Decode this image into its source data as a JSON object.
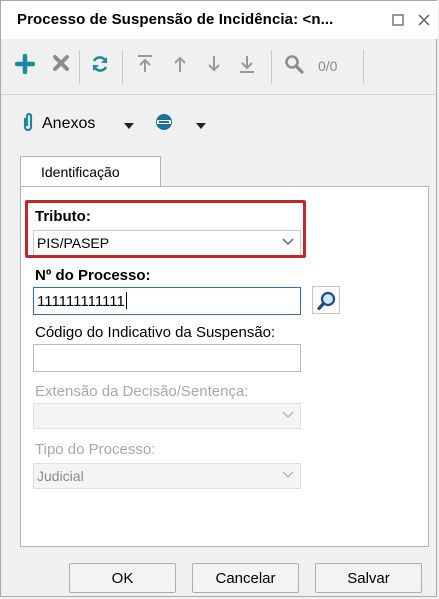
{
  "window": {
    "title": "Processo de Suspensão de Incidência: <n...",
    "maximize_icon": "maximize-icon",
    "close_icon": "close-icon"
  },
  "toolbar": {
    "items": [
      "add-icon",
      "delete-icon",
      "refresh-icon",
      "move-first-icon",
      "move-up-icon",
      "move-down-icon",
      "move-last-icon",
      "search-icon"
    ],
    "search_count": "0/0",
    "colors": {
      "add": "#1c8a9a",
      "delete": "#8d8d8d",
      "refresh": "#1c8a9a",
      "arrows": "#9a9a9a"
    }
  },
  "attachments": {
    "label": "Anexos",
    "icon": "paperclip-icon",
    "second_icon": "eye-icon"
  },
  "tabs": [
    {
      "label": "Identificação",
      "active": true
    }
  ],
  "form": {
    "tributo": {
      "label": "Tributo:",
      "value": "PIS/PASEP"
    },
    "numero_processo": {
      "label": "Nº do Processo:",
      "value": "111111111111"
    },
    "codigo_indicativo": {
      "label": "Código do Indicativo da Suspensão:",
      "value": ""
    },
    "extensao_decisao": {
      "label": "Extensão da Decisão/Sentença:",
      "value": ""
    },
    "tipo_processo": {
      "label": "Tipo do Processo:",
      "value": "Judicial"
    },
    "highlight_color": "#c0282e"
  },
  "buttons": {
    "ok": "OK",
    "cancel": "Cancelar",
    "save": "Salvar"
  }
}
